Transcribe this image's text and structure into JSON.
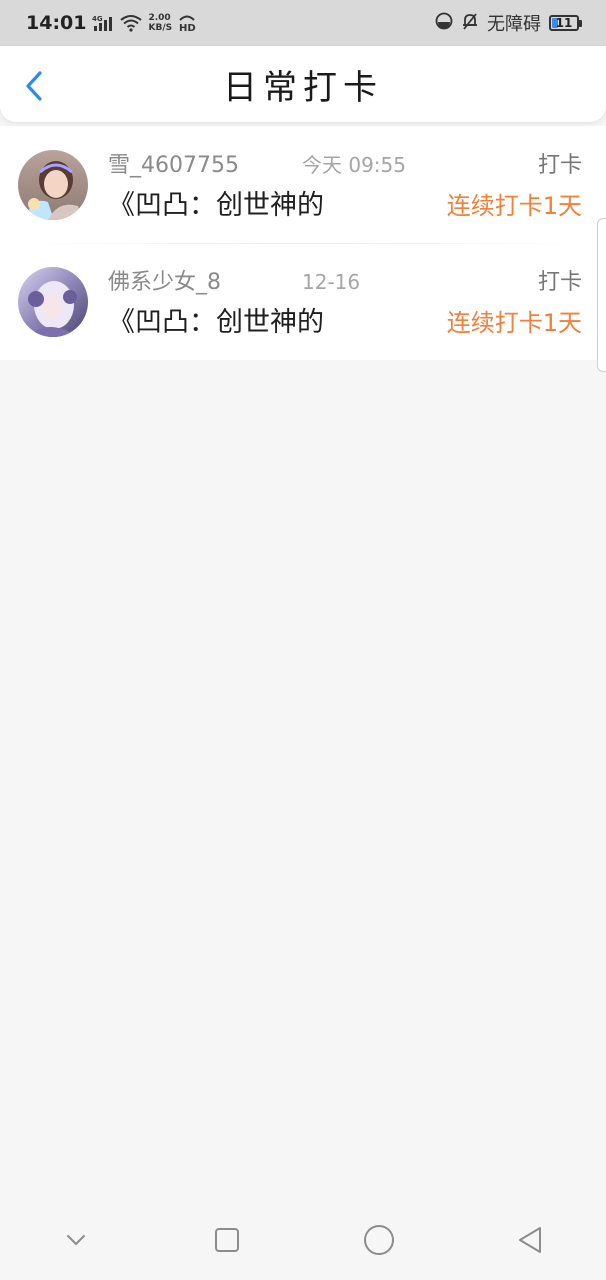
{
  "status_bar": {
    "time": "14:01",
    "network_type": "4G",
    "net_speed_value": "2.00",
    "net_speed_unit": "KB/S",
    "hd": "HD",
    "accessibility_label": "无障碍",
    "battery_level": "11"
  },
  "header": {
    "title": "日常打卡"
  },
  "list": [
    {
      "username": "雪_4607755",
      "time": "今天 09:55",
      "action": "打卡",
      "book_title": "《凹凸：创世神的",
      "streak": "连续打卡1天"
    },
    {
      "username": "佛系少女_8",
      "time": "12-16",
      "action": "打卡",
      "book_title": "《凹凸：创世神的",
      "streak": "连续打卡1天"
    }
  ],
  "colors": {
    "accent_blue": "#2e8be6",
    "streak_orange": "#f0803a",
    "page_background": "#f7f6f7"
  },
  "icons": {
    "back": "chevron-left-icon",
    "nav_down": "chevron-down-icon",
    "nav_recent": "square-icon",
    "nav_home": "circle-icon",
    "nav_back": "triangle-back-icon"
  }
}
